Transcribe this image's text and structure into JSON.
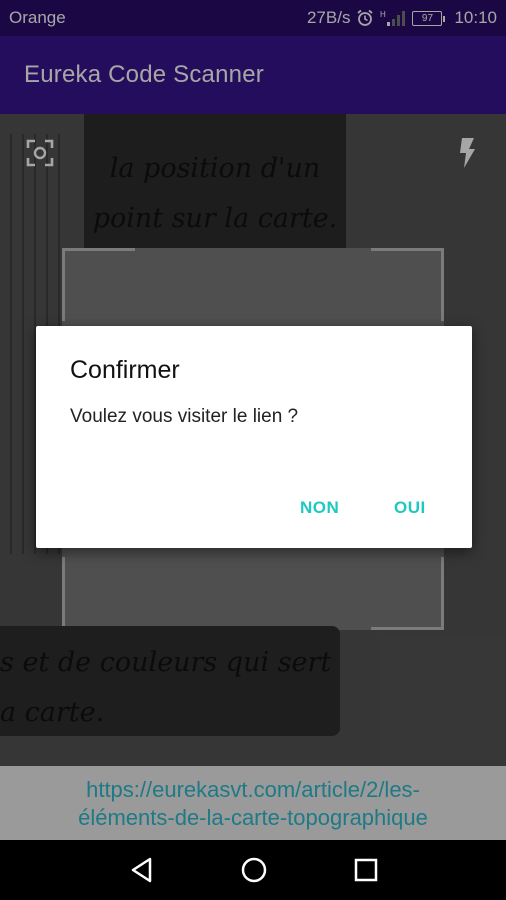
{
  "status_bar": {
    "carrier": "Orange",
    "speed": "27B/s",
    "battery": "97",
    "time": "10:10"
  },
  "app_bar": {
    "title": "Eureka Code Scanner"
  },
  "camera": {
    "text_top_lines": [
      "la position d'un",
      "point sur la carte."
    ],
    "text_bottom_lines": [
      "s et de couleurs qui sert",
      "a carte."
    ]
  },
  "result": {
    "url_line1": "https://eurekasvt.com/article/2/les-",
    "url_line2": "éléments-de-la-carte-topographique"
  },
  "dialog": {
    "title": "Confirmer",
    "message": "Voulez vous visiter le lien ?",
    "negative": "NON",
    "positive": "OUI"
  },
  "colors": {
    "status_bar": "#2b0c6b",
    "app_bar": "#3a148f",
    "accent": "#1ec8c3",
    "link": "#1d7a86"
  },
  "icons": [
    "focus-icon",
    "flash-icon",
    "back-icon",
    "home-icon",
    "recents-icon",
    "alarm-icon",
    "signal-icon",
    "battery-icon"
  ]
}
